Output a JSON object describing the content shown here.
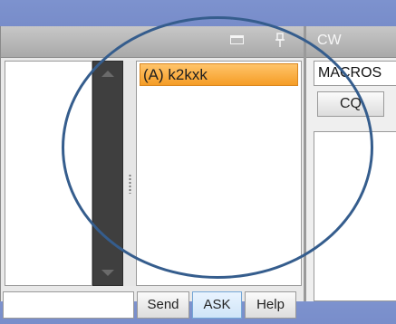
{
  "chat_panel": {
    "user_list": [
      {
        "label": "(A) k2kxk",
        "selected": true
      }
    ],
    "input": {
      "value": "",
      "placeholder": ""
    },
    "buttons": {
      "send": "Send",
      "ask": "ASK",
      "help": "Help"
    }
  },
  "cw_panel": {
    "title": "CW",
    "macros_select": "MACROS",
    "cq_button": "CQ"
  },
  "colors": {
    "background": "#6f84c4",
    "accent": "#f59d26",
    "highlight_ring": "#355d8d"
  }
}
